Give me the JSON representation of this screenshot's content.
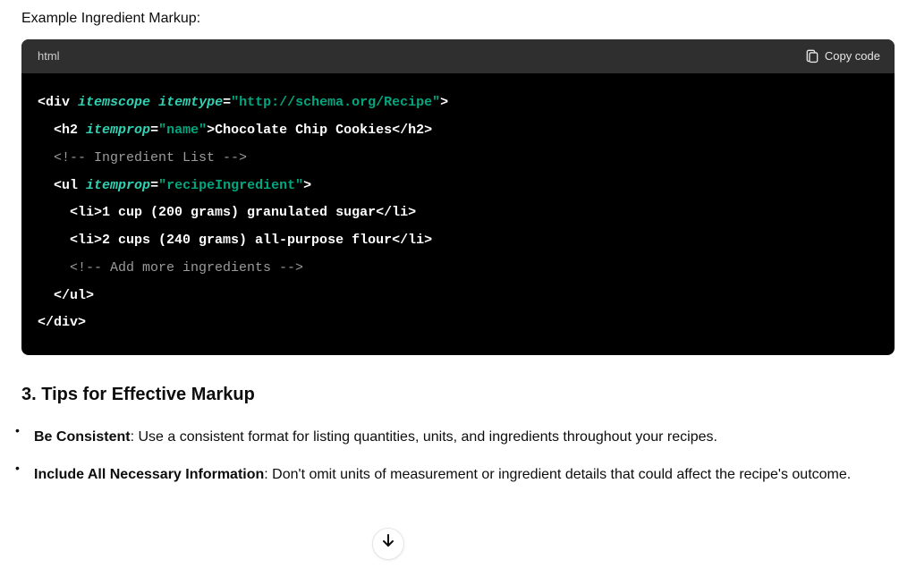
{
  "intro_heading": "Example Ingredient Markup:",
  "code": {
    "lang": "html",
    "copy_label": "Copy code",
    "lines": {
      "l1_tag_open": "<div",
      "l1_attr1": "itemscope",
      "l1_attr2": "itemtype",
      "l1_val": "\"http://schema.org/Recipe\"",
      "l1_close": ">",
      "l2_tag_open": "<h2",
      "l2_attr": "itemprop",
      "l2_val": "\"name\"",
      "l2_mid": ">Chocolate Chip Cookies</h2>",
      "l3_comment": "<!-- Ingredient List -->",
      "l4_tag_open": "<ul",
      "l4_attr": "itemprop",
      "l4_val": "\"recipeIngredient\"",
      "l4_close": ">",
      "l5": "<li>1 cup (200 grams) granulated sugar</li>",
      "l6": "<li>2 cups (240 grams) all-purpose flour</li>",
      "l7_comment": "<!-- Add more ingredients -->",
      "l8": "</ul>",
      "l9": "</div>"
    }
  },
  "section_heading": "3. Tips for Effective Markup",
  "tips": [
    {
      "title": "Be Consistent",
      "body": ": Use a consistent format for listing quantities, units, and ingredients throughout your recipes."
    },
    {
      "title": "Include All Necessary Information",
      "body": ": Don't omit units of measurement or ingredient details that could affect the recipe's outcome."
    }
  ]
}
